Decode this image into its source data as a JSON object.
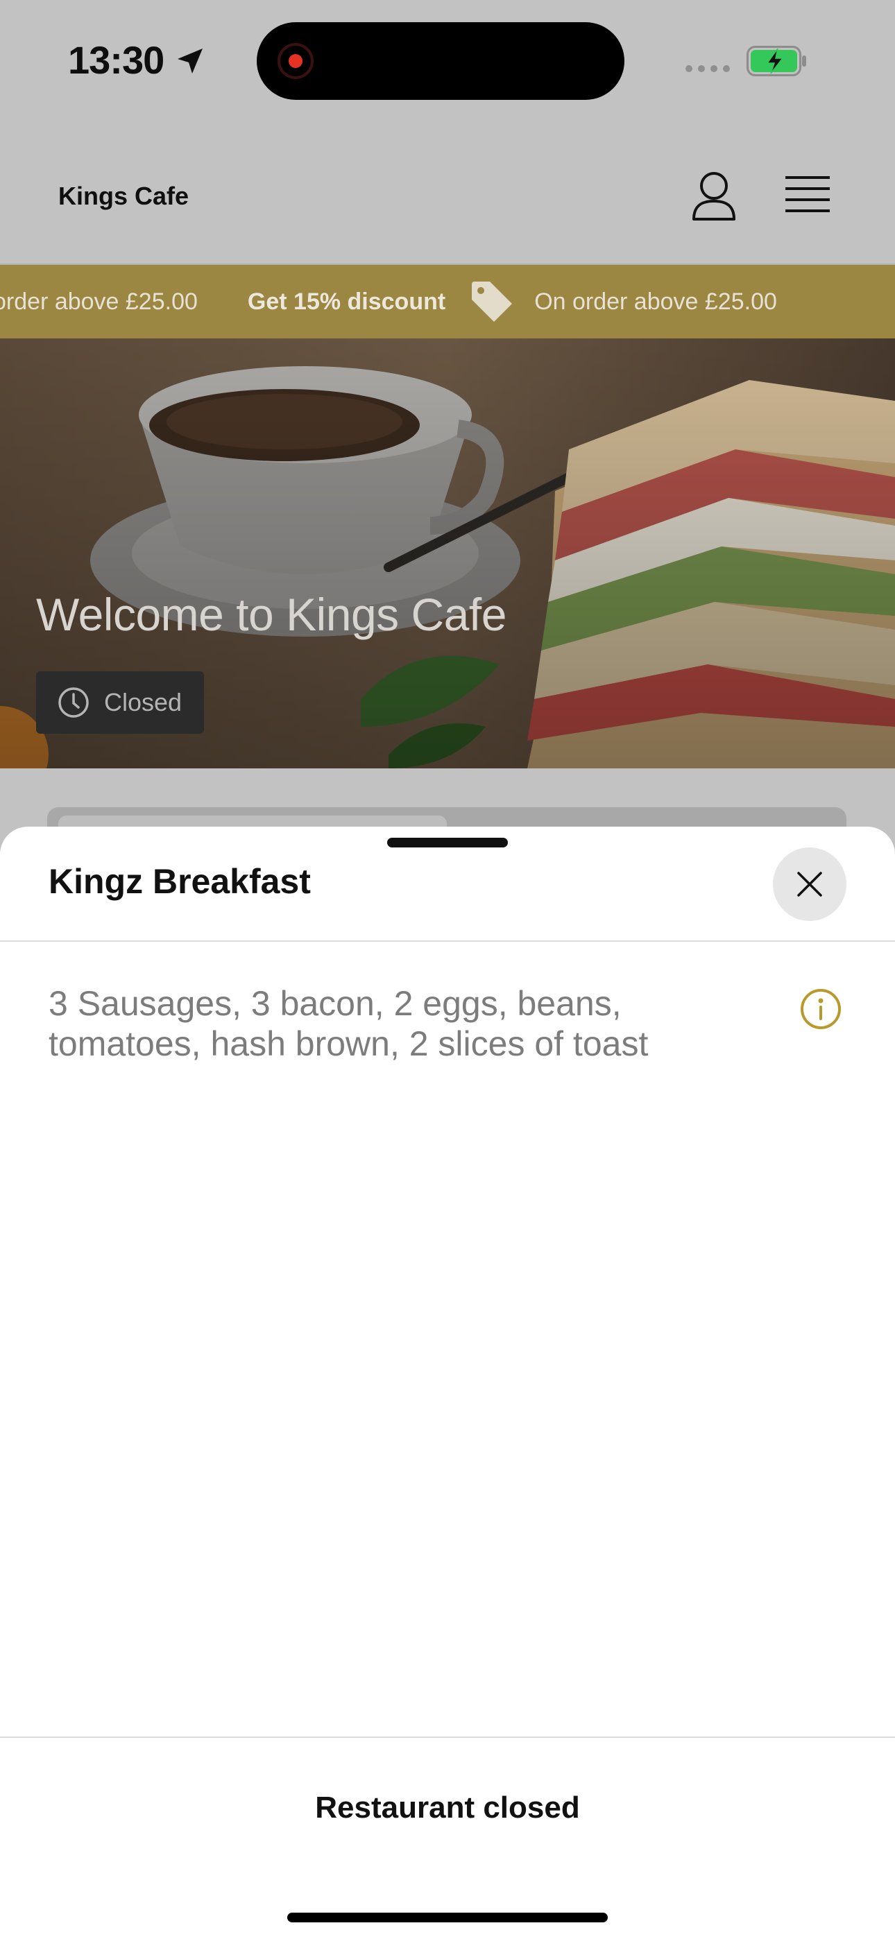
{
  "status_bar": {
    "time": "13:30",
    "location_icon": "location-arrow-icon",
    "recording_indicator": "record-dot-icon",
    "battery_icon": "battery-charging-icon",
    "colors": {
      "recording": "#e53224",
      "battery": "#34c759"
    }
  },
  "header": {
    "brand": "Kings Cafe",
    "user_icon": "user-icon",
    "menu_icon": "hamburger-menu-icon"
  },
  "promo": {
    "items": [
      {
        "headline": "",
        "detail": "order above £25.00"
      },
      {
        "headline": "Get 15% discount",
        "detail": "On order above £25.00"
      }
    ],
    "icon": "price-tag-icon",
    "color": "#9b8642"
  },
  "hero": {
    "title": "Welcome to Kings Cafe",
    "status": "Closed",
    "status_icon": "clock-icon"
  },
  "sheet": {
    "title": "Kingz Breakfast",
    "close_icon": "close-icon",
    "description": "3 Sausages, 3 bacon, 2 eggs, beans, tomatoes, hash brown, 2 slices of toast",
    "info_icon": "info-icon",
    "accent": "#b89a2c",
    "footer": "Restaurant closed"
  }
}
